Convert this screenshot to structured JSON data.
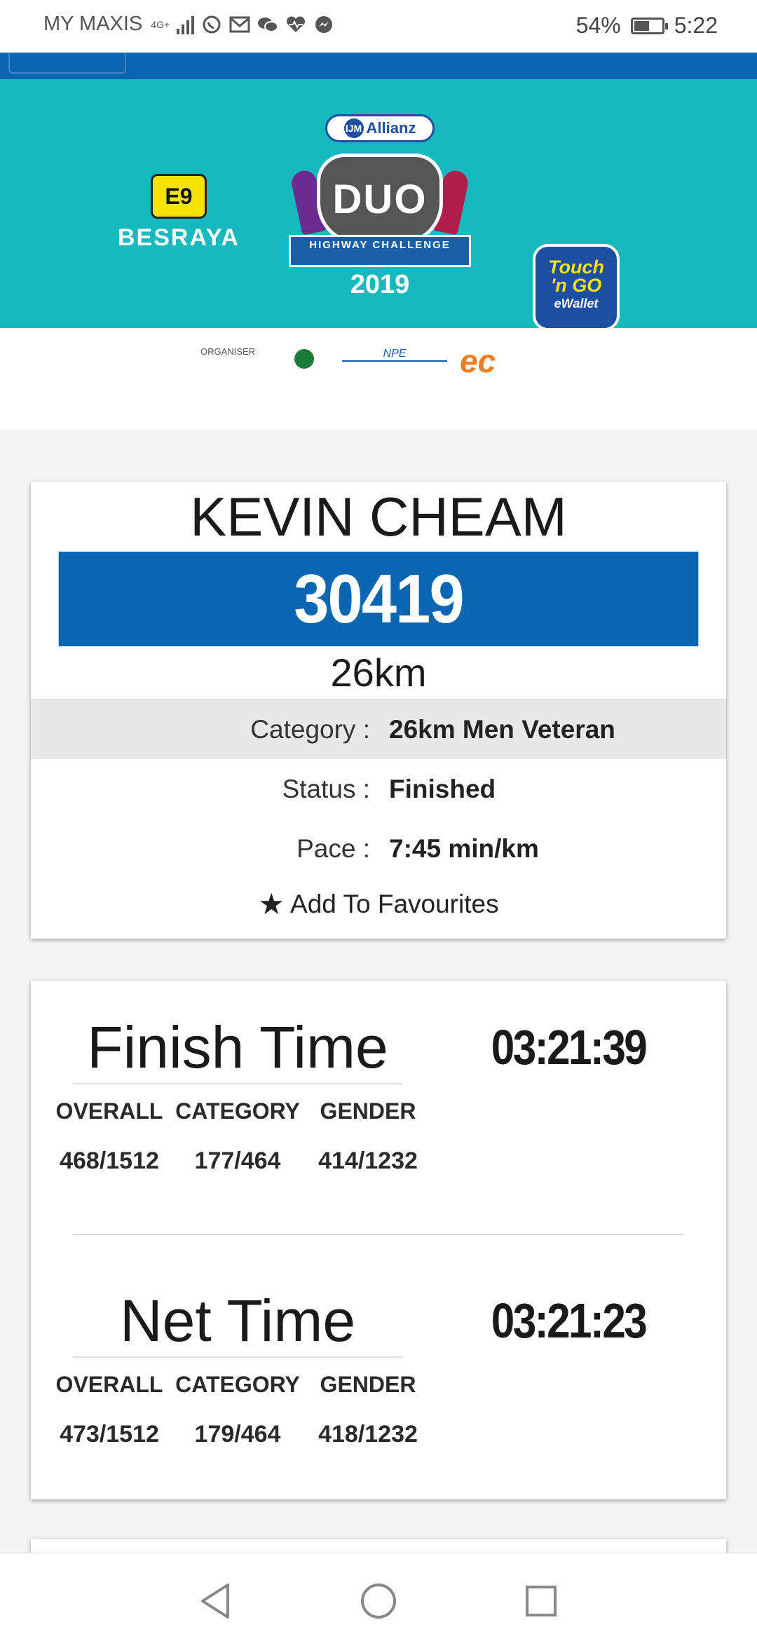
{
  "status_bar": {
    "carrier": "MY MAXIS",
    "network": "4G+",
    "battery_percent": "54%",
    "battery_level": 0.54,
    "time": "5:22",
    "notification_icons": [
      "whatsapp-icon",
      "gmail-icon",
      "wechat-icon",
      "health-icon",
      "messenger-icon"
    ]
  },
  "banner": {
    "sponsor_left": "BESRAYA",
    "sponsor_left_badge": "E9",
    "event_sponsor": "Allianz",
    "event_sponsor_badge": "IJM",
    "event_logo_main": "DUO",
    "event_logo_sub": "HIGHWAY CHALLENGE",
    "event_year": "2019",
    "sponsor_right_line1": "Touch",
    "sponsor_right_line2": "'n GO",
    "sponsor_right_line3": "eWallet",
    "organiser_label": "ORGANISER",
    "organiser_npe": "NPE",
    "organiser_ec": "ec"
  },
  "runner": {
    "name": "KEVIN CHEAM",
    "bib": "30419",
    "distance": "26km",
    "category_label": "Category :",
    "category_value": "26km Men Veteran",
    "status_label": "Status :",
    "status_value": "Finished",
    "pace_label": "Pace :",
    "pace_value": "7:45 min/km",
    "favourite_label": "Add To Favourites"
  },
  "results": {
    "column_headers": [
      "OVERALL",
      "CATEGORY",
      "GENDER"
    ],
    "finish": {
      "title": "Finish Time",
      "time": "03:21:39",
      "ranks": [
        "468/1512",
        "177/464",
        "414/1232"
      ]
    },
    "net": {
      "title": "Net Time",
      "time": "03:21:23",
      "ranks": [
        "473/1512",
        "179/464",
        "418/1232"
      ]
    }
  },
  "colors": {
    "brand_blue": "#0a66b0",
    "banner_teal": "#16b9bd",
    "row_shade": "#e8e8e8"
  }
}
